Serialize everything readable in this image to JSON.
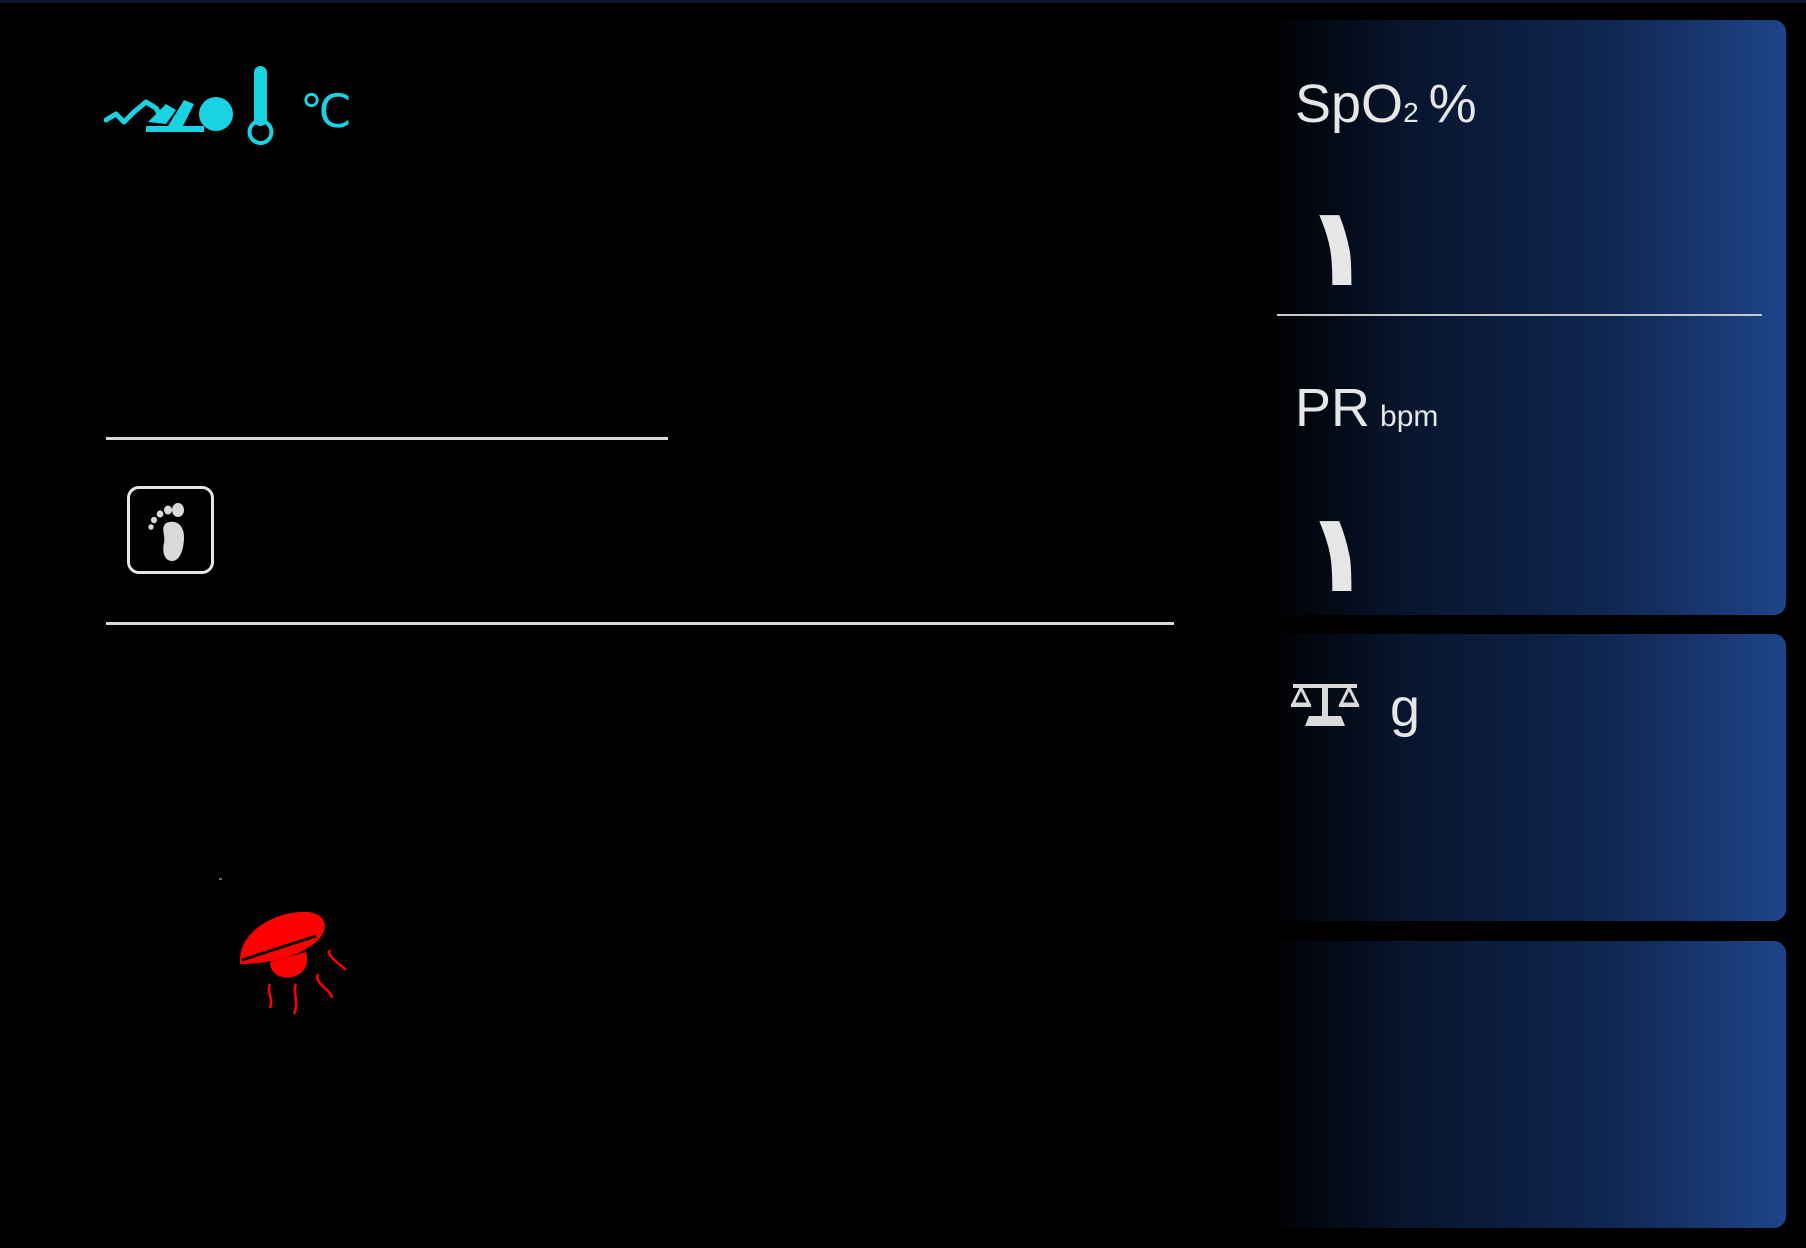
{
  "temperature": {
    "icon": "baby-skin-temperature-icon",
    "unit": "℃",
    "accent_color": "#19d3e3"
  },
  "foot_icon": "baby-foot-icon",
  "heater_icon": "radiant-heater-icon",
  "heater_color": "#ff0000",
  "spo2": {
    "label": "SpO",
    "subscript": "2",
    "unit": "%",
    "value": "١"
  },
  "pr": {
    "label": "PR",
    "unit": "bpm",
    "value": "١"
  },
  "weight": {
    "icon": "scale-icon",
    "unit": "g"
  },
  "panel_gradient": [
    "#000000",
    "#1e4489"
  ]
}
